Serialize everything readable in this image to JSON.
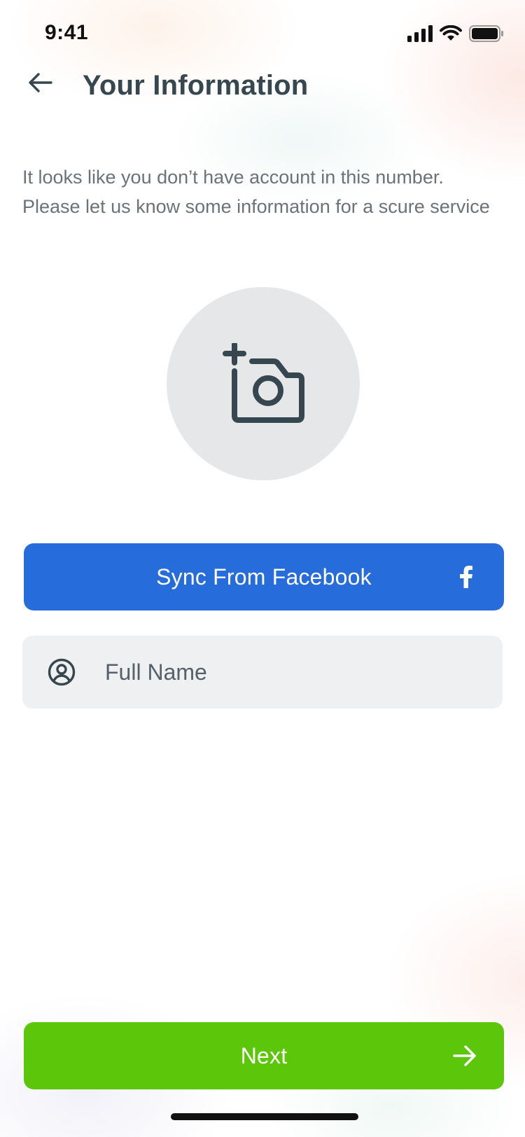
{
  "status_bar": {
    "time": "9:41",
    "icons": [
      "cellular-signal-icon",
      "wifi-icon",
      "battery-icon"
    ]
  },
  "header": {
    "back_icon": "arrow-left-icon",
    "title": "Your Information"
  },
  "description": "It looks like you don’t have account in this number. Please let us know some information for a scure service",
  "photo_picker": {
    "icon": "add-photo-camera-icon"
  },
  "facebook_button": {
    "label": "Sync From Facebook",
    "icon": "facebook-icon",
    "color": "#266cdb"
  },
  "name_field": {
    "icon": "user-circle-icon",
    "placeholder": "Full Name",
    "value": ""
  },
  "next_button": {
    "label": "Next",
    "icon": "arrow-right-icon",
    "color": "#5cc60a"
  },
  "colors": {
    "text_primary": "#37474f",
    "text_secondary": "#6b7378",
    "field_bg": "#eff0f1",
    "avatar_bg": "#e6e7e8"
  }
}
